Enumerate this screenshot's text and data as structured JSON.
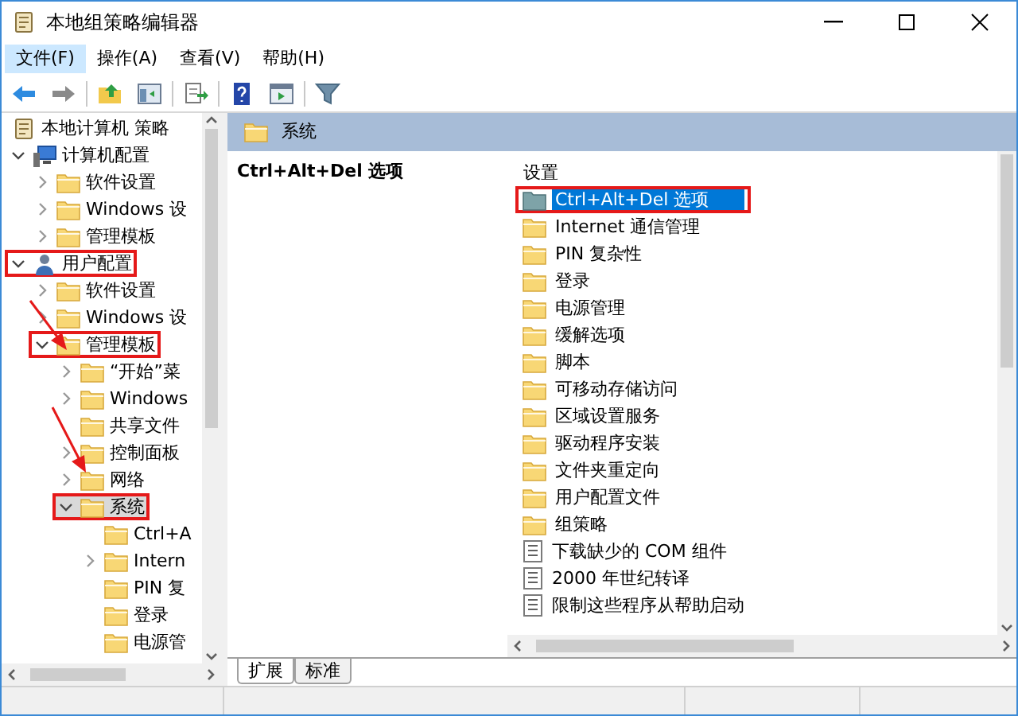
{
  "window": {
    "title": "本地组策略编辑器"
  },
  "menu": [
    {
      "label": "文件(F)",
      "selected": true
    },
    {
      "label": "操作(A)",
      "selected": false
    },
    {
      "label": "查看(V)",
      "selected": false
    },
    {
      "label": "帮助(H)",
      "selected": false
    }
  ],
  "toolbar": [
    {
      "kind": "back"
    },
    {
      "kind": "forward"
    },
    {
      "kind": "sep"
    },
    {
      "kind": "up"
    },
    {
      "kind": "tree"
    },
    {
      "kind": "sep"
    },
    {
      "kind": "export"
    },
    {
      "kind": "sep"
    },
    {
      "kind": "help"
    },
    {
      "kind": "view"
    },
    {
      "kind": "sep"
    },
    {
      "kind": "filter"
    }
  ],
  "tree": [
    {
      "label": "本地计算机 策略",
      "kind": "policy",
      "selected": false,
      "annotated": false,
      "children": [
        {
          "label": "计算机配置",
          "kind": "computer",
          "expanded": true,
          "selected": false,
          "annotated": false,
          "children": [
            {
              "label": "软件设置",
              "kind": "folder",
              "expanded": false,
              "selected": false,
              "annotated": false
            },
            {
              "label": "Windows 设",
              "kind": "folder",
              "expanded": false,
              "selected": false,
              "annotated": false
            },
            {
              "label": "管理模板",
              "kind": "folder",
              "expanded": false,
              "selected": false,
              "annotated": false
            }
          ]
        },
        {
          "label": "用户配置",
          "kind": "user",
          "expanded": true,
          "selected": false,
          "annotated": true,
          "children": [
            {
              "label": "软件设置",
              "kind": "folder",
              "expanded": false,
              "selected": false,
              "annotated": false
            },
            {
              "label": "Windows 设",
              "kind": "folder",
              "expanded": false,
              "selected": false,
              "annotated": false
            },
            {
              "label": "管理模板",
              "kind": "folder",
              "expanded": true,
              "selected": false,
              "annotated": true,
              "children": [
                {
                  "label": "“开始”菜",
                  "kind": "folder",
                  "expanded": false,
                  "selected": false,
                  "annotated": false
                },
                {
                  "label": "Windows",
                  "kind": "folder",
                  "expanded": false,
                  "selected": false,
                  "annotated": false
                },
                {
                  "label": "共享文件",
                  "kind": "folder",
                  "selected": false,
                  "annotated": false
                },
                {
                  "label": "控制面板",
                  "kind": "folder",
                  "expanded": false,
                  "selected": false,
                  "annotated": false
                },
                {
                  "label": "网络",
                  "kind": "folder",
                  "expanded": false,
                  "selected": false,
                  "annotated": false
                },
                {
                  "label": "系统",
                  "kind": "folder",
                  "expanded": true,
                  "selected": true,
                  "annotated": true,
                  "children": [
                    {
                      "label": "Ctrl+A",
                      "kind": "folder",
                      "selected": false,
                      "annotated": false
                    },
                    {
                      "label": "Intern",
                      "kind": "folder",
                      "expanded": false,
                      "selected": false,
                      "annotated": false
                    },
                    {
                      "label": "PIN 复",
                      "kind": "folder",
                      "selected": false,
                      "annotated": false
                    },
                    {
                      "label": "登录",
                      "kind": "folder",
                      "selected": false,
                      "annotated": false
                    },
                    {
                      "label": "电源管",
                      "kind": "folder",
                      "selected": false,
                      "annotated": false
                    }
                  ]
                }
              ]
            }
          ]
        }
      ]
    }
  ],
  "details": {
    "header": "系统",
    "description_title": "Ctrl+Alt+Del 选项",
    "column": "设置",
    "items": [
      {
        "label": "Ctrl+Alt+Del 选项",
        "kind": "folder",
        "selected": true,
        "annotated": true
      },
      {
        "label": "Internet 通信管理",
        "kind": "folder",
        "selected": false,
        "annotated": false
      },
      {
        "label": "PIN 复杂性",
        "kind": "folder",
        "selected": false,
        "annotated": false
      },
      {
        "label": "登录",
        "kind": "folder",
        "selected": false,
        "annotated": false
      },
      {
        "label": "电源管理",
        "kind": "folder",
        "selected": false,
        "annotated": false
      },
      {
        "label": "缓解选项",
        "kind": "folder",
        "selected": false,
        "annotated": false
      },
      {
        "label": "脚本",
        "kind": "folder",
        "selected": false,
        "annotated": false
      },
      {
        "label": "可移动存储访问",
        "kind": "folder",
        "selected": false,
        "annotated": false
      },
      {
        "label": "区域设置服务",
        "kind": "folder",
        "selected": false,
        "annotated": false
      },
      {
        "label": "驱动程序安装",
        "kind": "folder",
        "selected": false,
        "annotated": false
      },
      {
        "label": "文件夹重定向",
        "kind": "folder",
        "selected": false,
        "annotated": false
      },
      {
        "label": "用户配置文件",
        "kind": "folder",
        "selected": false,
        "annotated": false
      },
      {
        "label": "组策略",
        "kind": "folder",
        "selected": false,
        "annotated": false
      },
      {
        "label": "下载缺少的 COM 组件",
        "kind": "setting",
        "selected": false,
        "annotated": false
      },
      {
        "label": "2000 年世纪转译",
        "kind": "setting",
        "selected": false,
        "annotated": false
      },
      {
        "label": "限制这些程序从帮助启动",
        "kind": "setting",
        "selected": false,
        "annotated": false
      }
    ]
  },
  "tabs": [
    {
      "label": "扩展",
      "selected": true
    },
    {
      "label": "标准",
      "selected": false
    }
  ]
}
